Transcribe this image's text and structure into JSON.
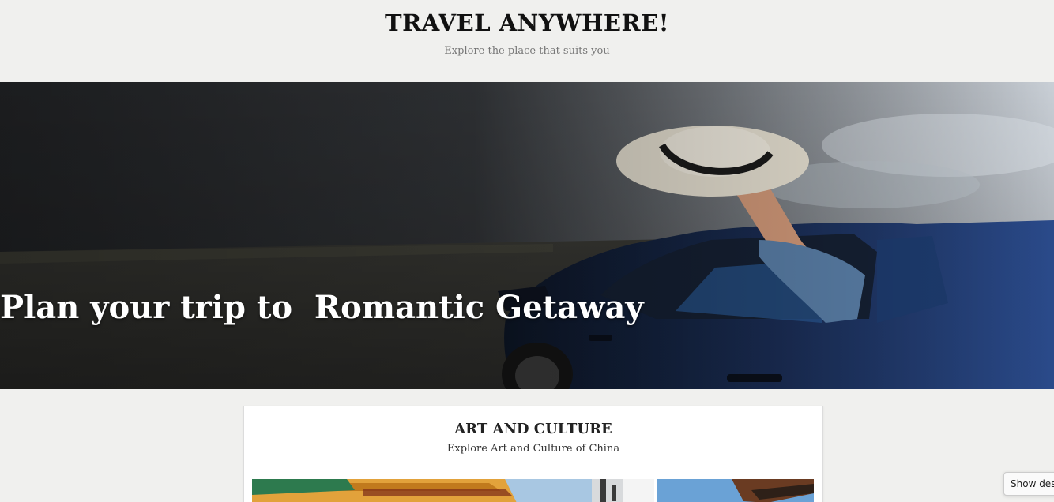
{
  "header": {
    "title": "TRAVEL ANYWHERE!",
    "subtitle": "Explore the place that suits you"
  },
  "hero": {
    "heading": "Plan your trip to  Romantic Getaway",
    "image_alt": "car-with-hat-out-window"
  },
  "card": {
    "title": "ART AND CULTURE",
    "description": "Explore Art and Culture of China",
    "photos": [
      "temple-roof-photo",
      "pagoda-sky-photo"
    ]
  },
  "floating_button": {
    "label": "Show desktop"
  }
}
